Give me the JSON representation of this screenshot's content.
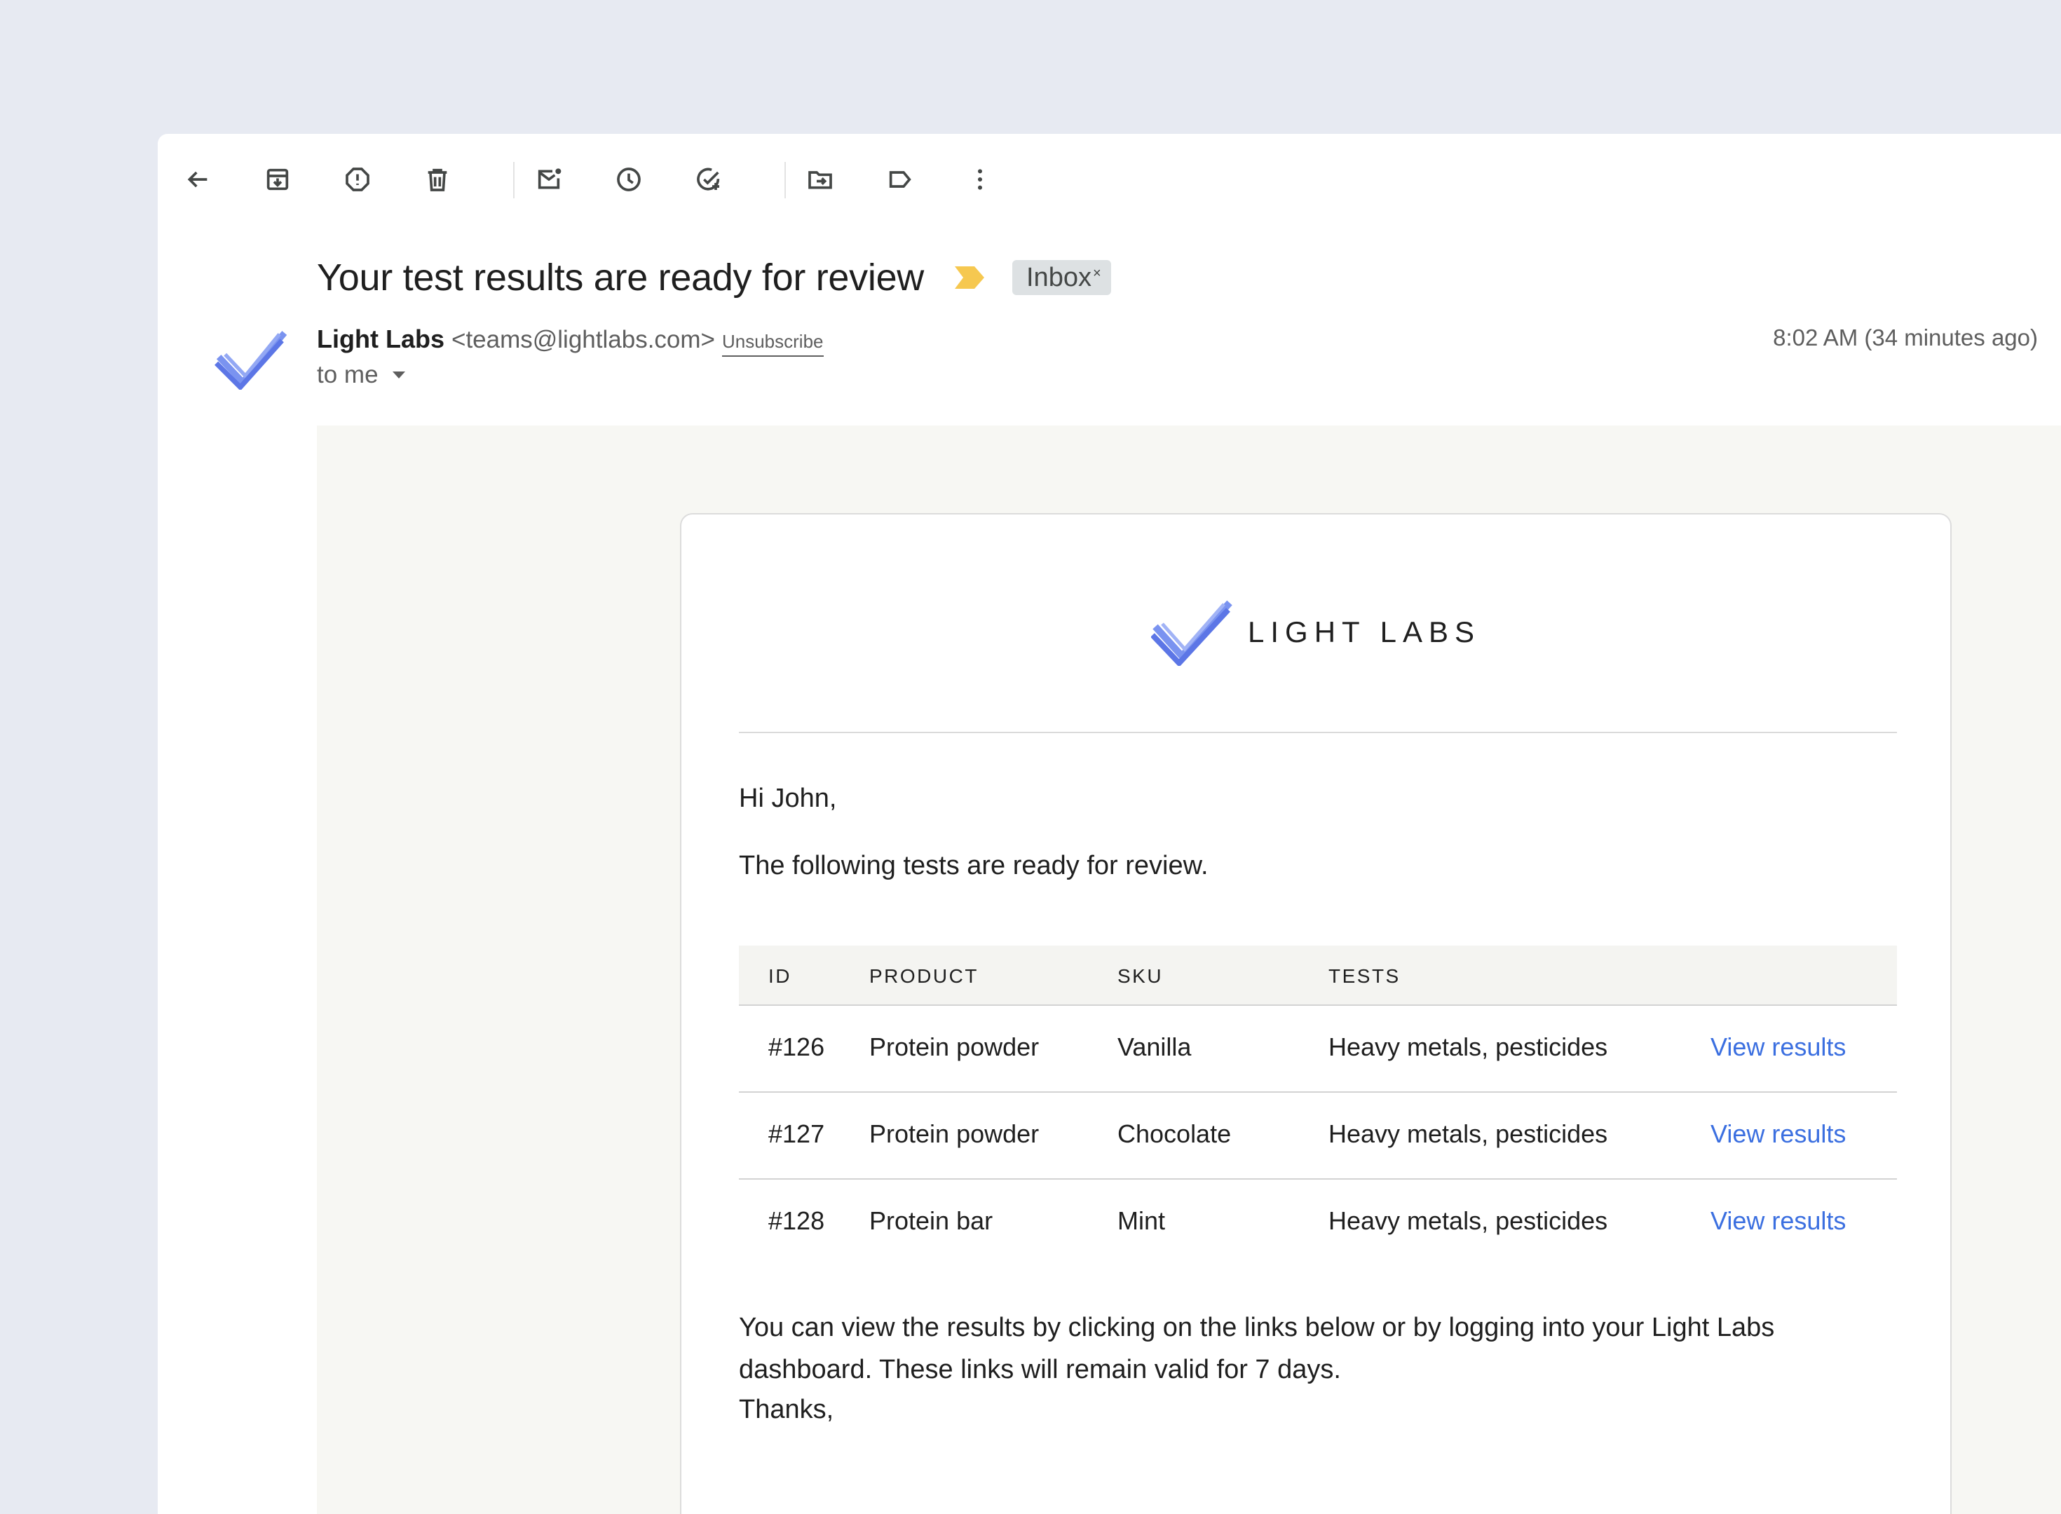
{
  "toolbar": {
    "icons": [
      "back-arrow-icon",
      "archive-icon",
      "report-spam-icon",
      "delete-icon",
      "mark-unread-icon",
      "snooze-icon",
      "add-task-icon",
      "move-to-icon",
      "label-icon",
      "more-vert-icon"
    ]
  },
  "email": {
    "subject": "Your test results are ready for review",
    "label_chip": "Inbox",
    "label_chip_close": "×",
    "importance_color": "#f4c430",
    "sender_name": "Light Labs",
    "sender_email": "<teams@lightlabs.com>",
    "unsubscribe": "Unsubscribe",
    "recipient": "to me",
    "timestamp": "8:02 AM (34 minutes ago)"
  },
  "message": {
    "brand": "LIGHT LABS",
    "brand_color": "#6f86ef",
    "greeting": "Hi John,",
    "intro": "The following tests are ready for review.",
    "table": {
      "headers": [
        "ID",
        "PRODUCT",
        "SKU",
        "TESTS"
      ],
      "rows": [
        {
          "id": "#126",
          "product": "Protein powder",
          "sku": "Vanilla",
          "tests": "Heavy metals, pesticides",
          "action": "View results"
        },
        {
          "id": "#127",
          "product": "Protein powder",
          "sku": "Chocolate",
          "tests": "Heavy metals, pesticides",
          "action": "View results"
        },
        {
          "id": "#128",
          "product": "Protein bar",
          "sku": "Mint",
          "tests": "Heavy metals, pesticides",
          "action": "View results"
        }
      ]
    },
    "paragraph": "You can view the results by clicking on the links below or by logging into your Light Labs dashboard. These links will remain valid for 7 days.",
    "signoff": "Thanks,"
  }
}
